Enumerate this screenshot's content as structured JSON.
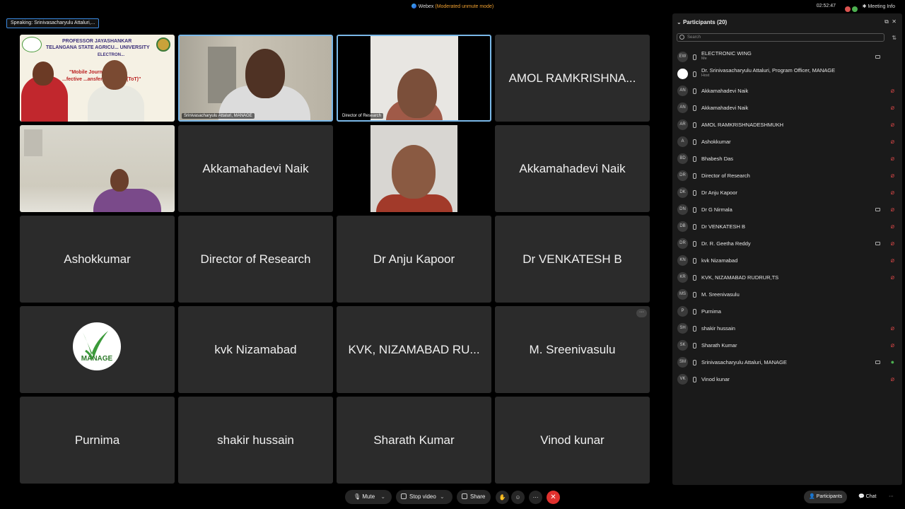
{
  "window": {
    "app_name": "Webex",
    "mode_text": "(Moderated unmute mode)",
    "clock": "02:52:47",
    "meeting_info_label": "Meeting Info"
  },
  "speaking": {
    "label": "Speaking:",
    "name": "Srinivasacharyulu Attaluri,..."
  },
  "banner": {
    "line1": "PROFESSOR JAYASHANKAR",
    "line2": "TELANGANA STATE AGRICU...    UNIVERSITY",
    "line3": "ELECTRON...",
    "line4": "\"Mobile Journali...  for",
    "line5": "...fective ...ansfer of T...ogy (ToT)\""
  },
  "video_labels": {
    "tile2": "Srinivasacharyulu Attaluri, MANAGE",
    "tile3": "Director of Research"
  },
  "tiles": [
    "AMOL RAMKRISHNA...",
    "Akkamahadevi Naik",
    "Akkamahadevi Naik",
    "Ashokkumar",
    "Director of Research",
    "Dr Anju Kapoor",
    "Dr VENKATESH B",
    "kvk Nizamabad",
    "KVK, NIZAMABAD RU...",
    "M. Sreenivasulu",
    "Purnima",
    "shakir hussain",
    "Sharath Kumar",
    "Vinod kunar"
  ],
  "logo_text": "MANAGE",
  "tile_more_label": "···",
  "participants": {
    "title": "Participants (20)",
    "search_placeholder": "Search",
    "list": [
      {
        "initials": "EW",
        "name": "ELECTRONIC WING",
        "sub": "Me",
        "state": "cam"
      },
      {
        "initials": "",
        "name": "Dr. Srinivasacharyulu Attaluri, Program Officer, MANAGE",
        "sub": "Host",
        "state": "none"
      },
      {
        "initials": "AN",
        "name": "Akkamahadevi Naik",
        "sub": "",
        "state": "muted"
      },
      {
        "initials": "AN",
        "name": "Akkamahadevi Naik",
        "sub": "",
        "state": "muted"
      },
      {
        "initials": "AR",
        "name": "AMOL RAMKRISHNADESHMUKH",
        "sub": "",
        "state": "muted"
      },
      {
        "initials": "A",
        "name": "Ashokkumar",
        "sub": "",
        "state": "muted"
      },
      {
        "initials": "BD",
        "name": "Bhabesh Das",
        "sub": "",
        "state": "muted"
      },
      {
        "initials": "DR",
        "name": "Director of Research",
        "sub": "",
        "state": "muted"
      },
      {
        "initials": "DK",
        "name": "Dr Anju Kapoor",
        "sub": "",
        "state": "muted"
      },
      {
        "initials": "DN",
        "name": "Dr G Nirmala",
        "sub": "",
        "state": "cam-muted"
      },
      {
        "initials": "DB",
        "name": "Dr VENKATESH B",
        "sub": "",
        "state": "muted"
      },
      {
        "initials": "DR",
        "name": "Dr. R. Geetha Reddy",
        "sub": "",
        "state": "cam-muted"
      },
      {
        "initials": "KN",
        "name": "kvk Nizamabad",
        "sub": "",
        "state": "muted"
      },
      {
        "initials": "KR",
        "name": "KVK, NIZAMABAD RUDRUR,TS",
        "sub": "",
        "state": "muted"
      },
      {
        "initials": "MS",
        "name": "M. Sreenivasulu",
        "sub": "",
        "state": "none"
      },
      {
        "initials": "P",
        "name": "Purnima",
        "sub": "",
        "state": "none"
      },
      {
        "initials": "SH",
        "name": "shakir hussain",
        "sub": "",
        "state": "muted"
      },
      {
        "initials": "SK",
        "name": "Sharath Kumar",
        "sub": "",
        "state": "muted"
      },
      {
        "initials": "SM",
        "name": "Srinivasacharyulu Attaluri, MANAGE",
        "sub": "",
        "state": "cam-on"
      },
      {
        "initials": "VK",
        "name": "Vinod kunar",
        "sub": "",
        "state": "muted"
      }
    ]
  },
  "controls": {
    "mute": "Mute",
    "stop_video": "Stop video",
    "share": "Share",
    "participants_tab": "Participants",
    "chat_tab": "Chat"
  },
  "colors": {
    "accent": "#7ab8e8",
    "end_call": "#e0312e",
    "muted": "#d64646",
    "mode": "#f0a030"
  }
}
